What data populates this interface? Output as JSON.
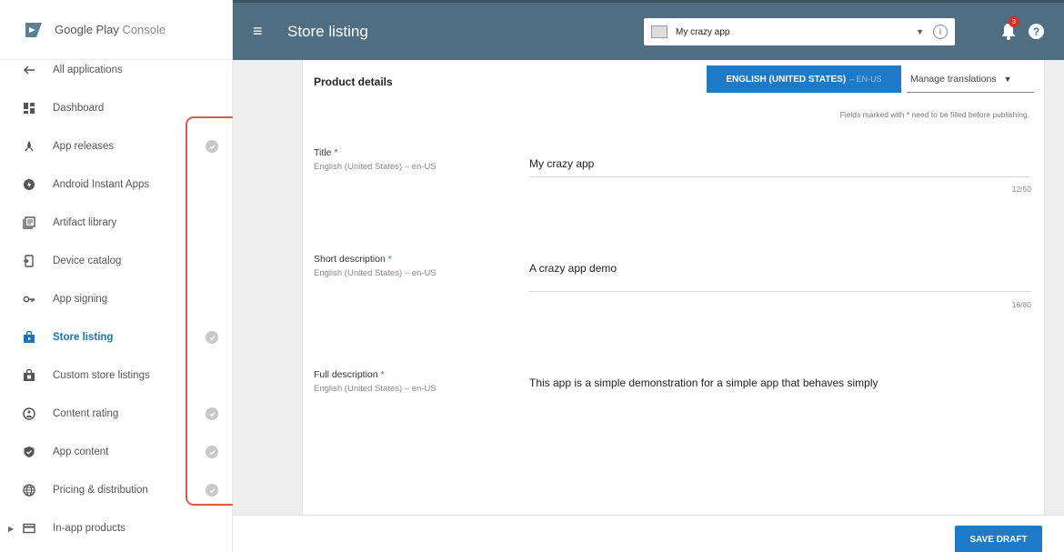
{
  "brand": {
    "name": "Google Play",
    "suffix": " Console"
  },
  "topbar": {
    "title": "Store listing",
    "app_name": "My crazy app",
    "info": "i",
    "help": "?",
    "notification_count": "3"
  },
  "sidebar": {
    "items": [
      {
        "label": "All applications",
        "icon": "arrow-left-icon",
        "checked": false
      },
      {
        "label": "Dashboard",
        "icon": "dashboard-icon",
        "checked": false
      },
      {
        "label": "App releases",
        "icon": "rocket-icon",
        "checked": true
      },
      {
        "label": "Android Instant Apps",
        "icon": "instant-app-icon",
        "checked": false
      },
      {
        "label": "Artifact library",
        "icon": "library-icon",
        "checked": false
      },
      {
        "label": "Device catalog",
        "icon": "device-icon",
        "checked": false
      },
      {
        "label": "App signing",
        "icon": "key-icon",
        "checked": false
      },
      {
        "label": "Store listing",
        "icon": "store-icon",
        "checked": true,
        "active": true
      },
      {
        "label": "Custom store listings",
        "icon": "store-outline-icon",
        "checked": false
      },
      {
        "label": "Content rating",
        "icon": "content-rating-icon",
        "checked": true
      },
      {
        "label": "App content",
        "icon": "shield-icon",
        "checked": true
      },
      {
        "label": "Pricing & distribution",
        "icon": "globe-icon",
        "checked": true
      },
      {
        "label": "In-app products",
        "icon": "card-icon",
        "checked": false,
        "expandable": true
      }
    ]
  },
  "card": {
    "title": "Product details",
    "language_button": {
      "label": "ENGLISH (UNITED STATES)",
      "code": "– EN-US"
    },
    "manage_translations": "Manage translations",
    "required_note_pre": "Fields marked with ",
    "required_star": "*",
    "required_note_post": " need to be filled before publishing.",
    "fields": [
      {
        "label": "Title",
        "sub": "English (United States) – en-US",
        "value": "My crazy app",
        "count": "12/50"
      },
      {
        "label": "Short description",
        "sub": "English (United States) – en-US",
        "value": "A crazy app demo",
        "count": "16/80"
      },
      {
        "label": "Full description",
        "sub": "English (United States) – en-US",
        "value": "This app is a simple demonstration for a simple app that behaves simply"
      }
    ]
  },
  "footer": {
    "save_label": "SAVE DRAFT"
  },
  "colors": {
    "topbar": "#4f6e81",
    "accent": "#1e7ac7",
    "highlight": "#e0584a",
    "active_nav": "#1a73b8"
  }
}
